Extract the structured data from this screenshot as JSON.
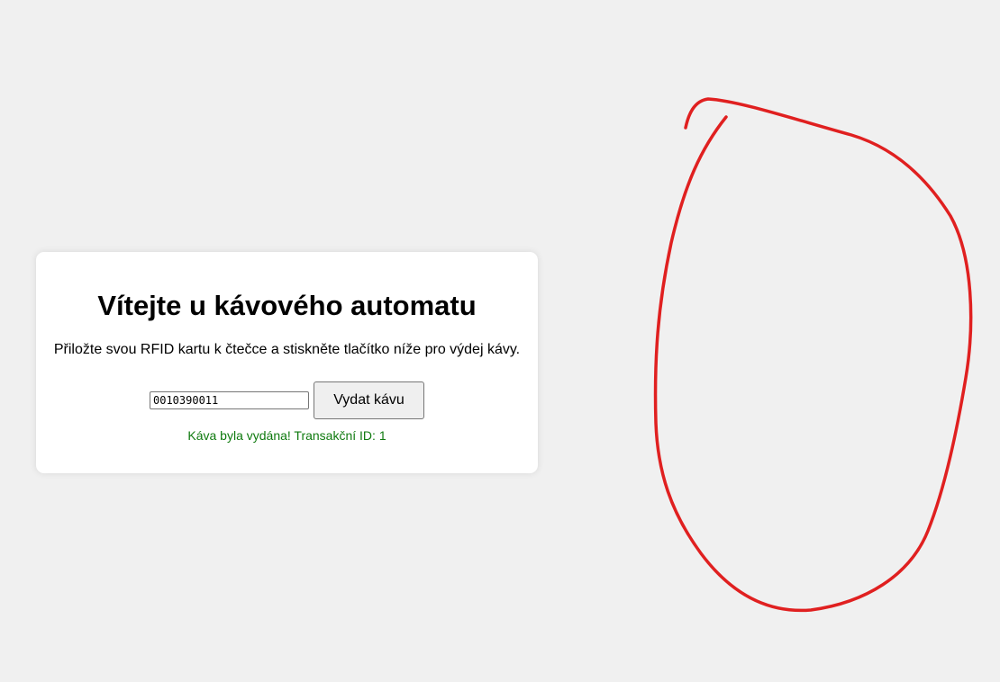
{
  "card": {
    "title": "Vítejte u kávového automatu",
    "subtitle": "Přiložte svou RFID kartu k čtečce a stiskněte tlačítko níže pro výdej kávy.",
    "rfid_input_value": "0010390011",
    "dispense_button_label": "Vydat kávu",
    "status_message": "Káva byla vydána! Transakční ID: 1"
  },
  "colors": {
    "background": "#f0f0f0",
    "card": "#ffffff",
    "success_text": "#0f7a0f",
    "annotation_stroke": "#e02020"
  }
}
